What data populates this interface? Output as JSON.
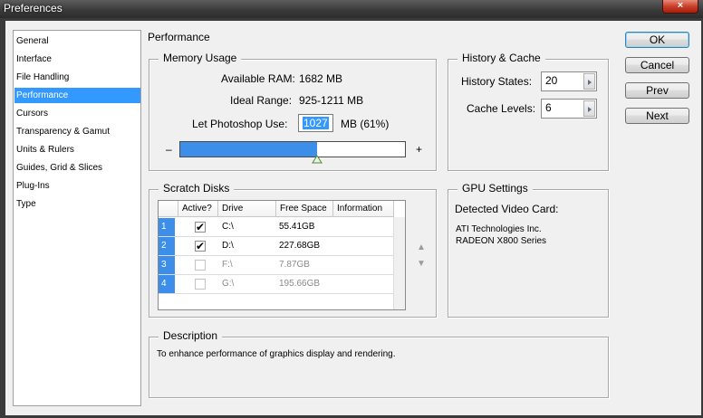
{
  "window": {
    "title": "Preferences",
    "close_glyph": "×"
  },
  "nav": {
    "items": [
      {
        "label": "General"
      },
      {
        "label": "Interface"
      },
      {
        "label": "File Handling"
      },
      {
        "label": "Performance",
        "selected": true
      },
      {
        "label": "Cursors"
      },
      {
        "label": "Transparency & Gamut"
      },
      {
        "label": "Units & Rulers"
      },
      {
        "label": "Guides, Grid & Slices"
      },
      {
        "label": "Plug-Ins"
      },
      {
        "label": "Type"
      }
    ]
  },
  "page_title": "Performance",
  "memory": {
    "legend": "Memory Usage",
    "available_label": "Available RAM:",
    "available_value": "1682 MB",
    "ideal_label": "Ideal Range:",
    "ideal_value": "925-1211 MB",
    "use_label": "Let Photoshop Use:",
    "use_value": "1027",
    "use_suffix": "MB (61%)",
    "minus": "–",
    "plus": "+",
    "slider_fraction": 0.61
  },
  "history": {
    "legend": "History & Cache",
    "states_label": "History States:",
    "states_value": "20",
    "cache_label": "Cache Levels:",
    "cache_value": "6"
  },
  "scratch": {
    "legend": "Scratch Disks",
    "columns": [
      "Active?",
      "Drive",
      "Free Space",
      "Information"
    ],
    "rows": [
      {
        "num": "1",
        "active": true,
        "drive": "C:\\",
        "free": "55.41GB",
        "info": ""
      },
      {
        "num": "2",
        "active": true,
        "drive": "D:\\",
        "free": "227.68GB",
        "info": ""
      },
      {
        "num": "3",
        "active": false,
        "drive": "F:\\",
        "free": "7.87GB",
        "info": ""
      },
      {
        "num": "4",
        "active": false,
        "drive": "G:\\",
        "free": "195.66GB",
        "info": ""
      }
    ],
    "check_glyph": "✔",
    "up_glyph": "▲",
    "down_glyph": "▼"
  },
  "gpu": {
    "legend": "GPU Settings",
    "detected_label": "Detected Video Card:",
    "vendor": "ATI Technologies Inc.",
    "model": "RADEON X800 Series"
  },
  "description": {
    "legend": "Description",
    "text": "To enhance performance of graphics display and rendering."
  },
  "buttons": {
    "ok": "OK",
    "cancel": "Cancel",
    "prev": "Prev",
    "next": "Next"
  },
  "colors": {
    "accent": "#3399ff",
    "slider_fill": "#3d8ee8"
  }
}
